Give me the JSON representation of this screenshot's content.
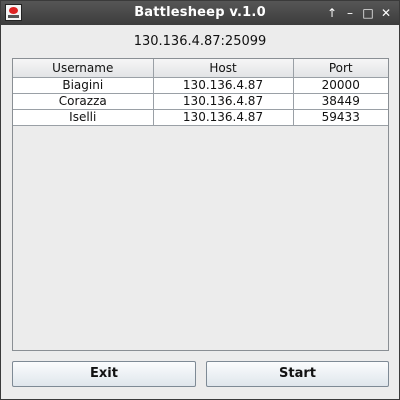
{
  "window": {
    "title": "Battlesheep v.1.0",
    "controls": {
      "up": "↑",
      "minimize": "–",
      "maximize": "□",
      "close": "✕"
    }
  },
  "server_address": "130.136.4.87:25099",
  "table": {
    "headers": [
      "Username",
      "Host",
      "Port"
    ],
    "rows": [
      [
        "Biagini",
        "130.136.4.87",
        "20000"
      ],
      [
        "Corazza",
        "130.136.4.87",
        "38449"
      ],
      [
        "Iselli",
        "130.136.4.87",
        "59433"
      ]
    ]
  },
  "buttons": {
    "exit": "Exit",
    "start": "Start"
  }
}
